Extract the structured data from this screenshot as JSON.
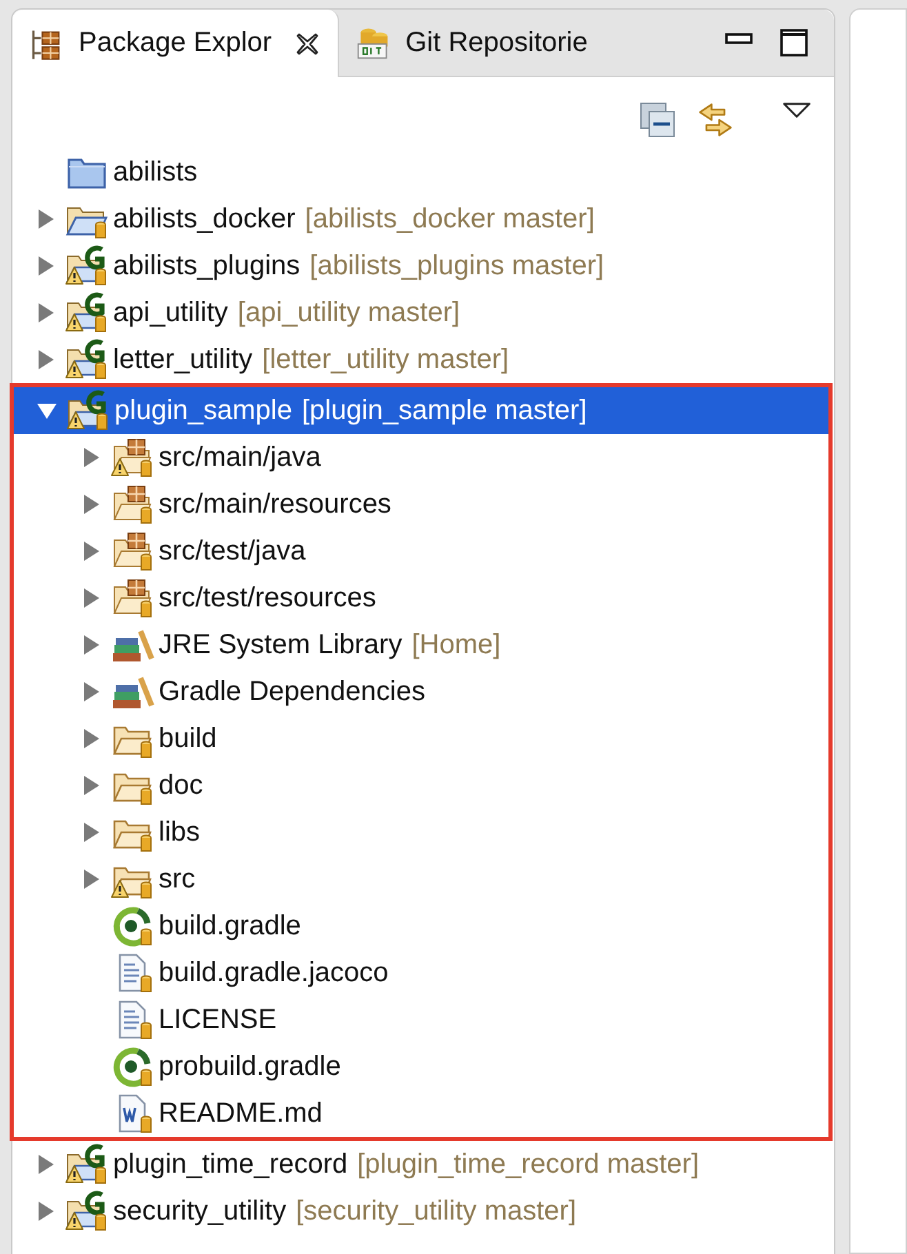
{
  "tabs": [
    {
      "label": "Package Explor",
      "selected": true,
      "kind": "package"
    },
    {
      "label": "Git Repositorie",
      "selected": false,
      "kind": "git"
    }
  ],
  "tree": [
    {
      "name": "abilists",
      "kind": "project",
      "warning": false,
      "selected": false
    },
    {
      "name": "abilists_docker",
      "decoration": "[abilists_docker master]",
      "kind": "shared-project",
      "warning": false,
      "expanded": false,
      "selected": false
    },
    {
      "name": "abilists_plugins",
      "decoration": "[abilists_plugins master]",
      "kind": "gradle-project",
      "warning": true,
      "expanded": false,
      "selected": false
    },
    {
      "name": "api_utility",
      "decoration": "[api_utility master]",
      "kind": "gradle-project",
      "warning": true,
      "expanded": false,
      "selected": false
    },
    {
      "name": "letter_utility",
      "decoration": "[letter_utility master]",
      "kind": "gradle-project",
      "warning": true,
      "expanded": false,
      "selected": false
    },
    {
      "name": "plugin_sample",
      "decoration": "[plugin_sample master]",
      "kind": "gradle-project",
      "warning": true,
      "expanded": true,
      "selected": true,
      "highlighted": true,
      "children": [
        {
          "name": "src/main/java",
          "kind": "source-folder",
          "warning": true,
          "expanded": false,
          "selected": false
        },
        {
          "name": "src/main/resources",
          "kind": "source-folder",
          "warning": false,
          "expanded": false,
          "selected": false
        },
        {
          "name": "src/test/java",
          "kind": "source-folder",
          "warning": false,
          "expanded": false,
          "selected": false
        },
        {
          "name": "src/test/resources",
          "kind": "source-folder",
          "warning": false,
          "expanded": false,
          "selected": false
        },
        {
          "name": "JRE System Library",
          "decoration": "[Home]",
          "kind": "library",
          "warning": false,
          "expanded": false,
          "selected": false
        },
        {
          "name": "Gradle Dependencies",
          "kind": "library",
          "warning": false,
          "expanded": false,
          "selected": false
        },
        {
          "name": "build",
          "kind": "folder",
          "warning": false,
          "expanded": false,
          "selected": false
        },
        {
          "name": "doc",
          "kind": "folder",
          "warning": false,
          "expanded": false,
          "selected": false
        },
        {
          "name": "libs",
          "kind": "folder",
          "warning": false,
          "expanded": false,
          "selected": false
        },
        {
          "name": "src",
          "kind": "folder",
          "warning": true,
          "expanded": false,
          "selected": false
        },
        {
          "name": "build.gradle",
          "kind": "gradle-file",
          "warning": false,
          "selected": false
        },
        {
          "name": "build.gradle.jacoco",
          "kind": "text-file",
          "warning": false,
          "selected": false
        },
        {
          "name": "LICENSE",
          "kind": "text-file",
          "warning": false,
          "selected": false
        },
        {
          "name": "probuild.gradle",
          "kind": "gradle-file",
          "warning": false,
          "selected": false
        },
        {
          "name": "README.md",
          "kind": "markdown-file",
          "warning": false,
          "selected": false
        }
      ]
    },
    {
      "name": "plugin_time_record",
      "decoration": "[plugin_time_record master]",
      "kind": "gradle-project",
      "warning": true,
      "expanded": false,
      "selected": false
    },
    {
      "name": "security_utility",
      "decoration": "[security_utility master]",
      "kind": "gradle-project",
      "warning": true,
      "expanded": false,
      "selected": false
    }
  ]
}
